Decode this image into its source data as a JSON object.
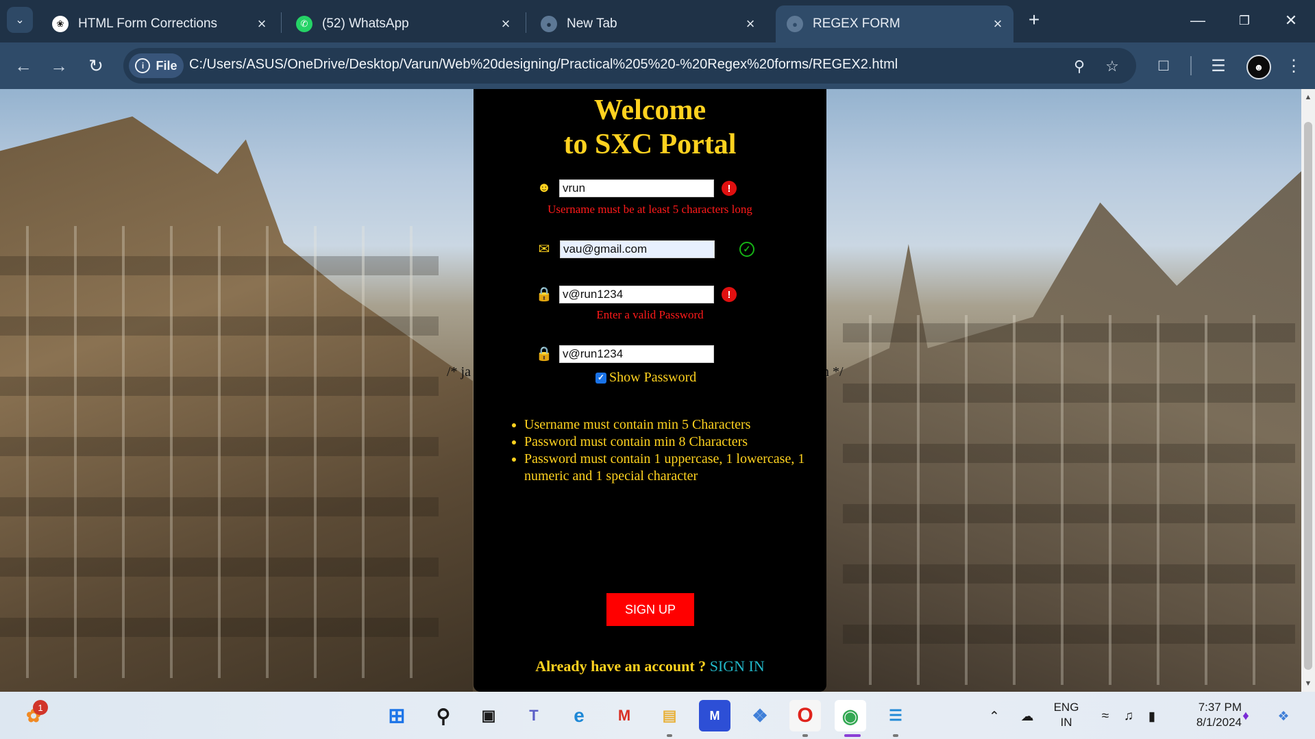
{
  "browser": {
    "tabs": [
      {
        "label": "HTML Form Corrections",
        "icon": "openai-icon"
      },
      {
        "label": "(52) WhatsApp",
        "icon": "whatsapp-icon"
      },
      {
        "label": "New Tab",
        "icon": "globe-icon"
      },
      {
        "label": "REGEX FORM",
        "icon": "globe-icon",
        "active": true
      }
    ],
    "site_chip": "File",
    "url": "C:/Users/ASUS/OneDrive/Desktop/Varun/Web%20designing/Practical%205%20-%20Regex%20forms/REGEX2.html"
  },
  "page": {
    "welcome_line1": "Welcome",
    "welcome_line2": "to SXC Portal",
    "stray_left": "/* ja",
    "stray_right": "n */",
    "username": {
      "value": "vrun",
      "error": "Username must be at least 5 characters long"
    },
    "email": {
      "value": "vau@gmail.com"
    },
    "password": {
      "value": "v@run1234",
      "error": "Enter a valid Password"
    },
    "confirm_password": {
      "value": "v@run1234"
    },
    "show_password": {
      "label": "Show Password",
      "checked": true
    },
    "rules": [
      "Username must contain min 5 Characters",
      "Password must contain min 8 Characters",
      "Password must contain 1 uppercase, 1 lowercase, 1 numeric and 1 special character"
    ],
    "signup_label": "SIGN UP",
    "already_text": "Already have an account ?",
    "signin_label": "SIGN IN"
  },
  "taskbar": {
    "notification_count": "1",
    "language_line1": "ENG",
    "language_line2": "IN",
    "time": "7:37 PM",
    "date": "8/1/2024"
  },
  "colors": {
    "accent_yellow": "#ffd21f",
    "error_red": "#ff1a1a",
    "signup_red": "#ff0000",
    "link_cyan": "#22b8c9",
    "panel_black": "#000000"
  }
}
